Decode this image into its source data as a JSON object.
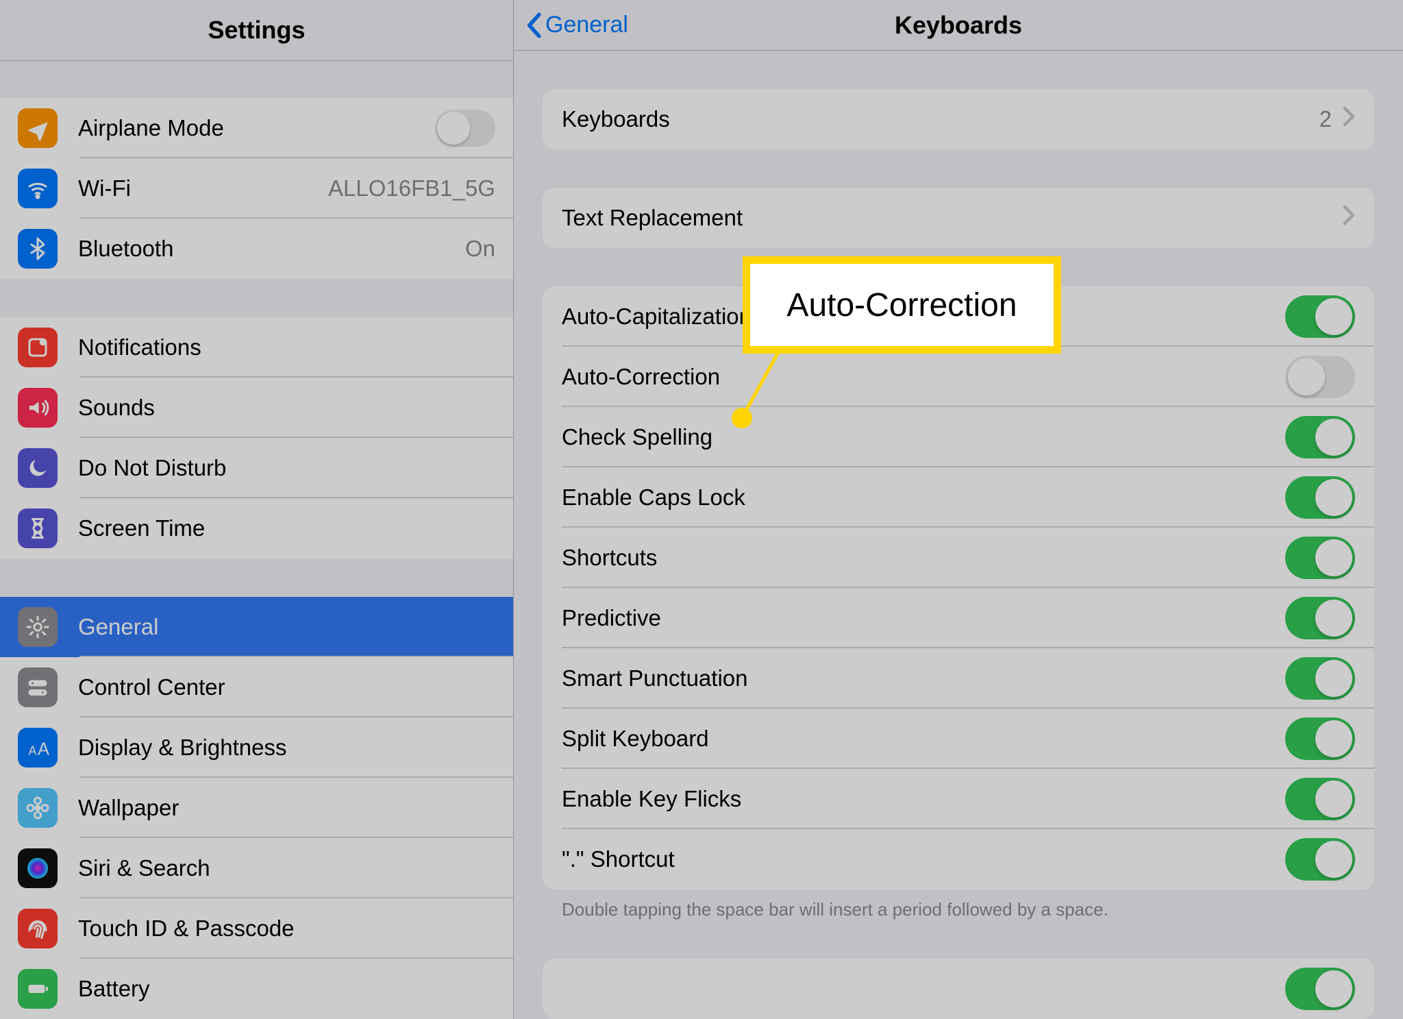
{
  "sidebar": {
    "title": "Settings",
    "groups": [
      {
        "items": [
          {
            "id": "airplane",
            "label": "Airplane Mode",
            "icon": "airplane-icon",
            "iconColor": "#ff9500",
            "type": "toggle",
            "on": false
          },
          {
            "id": "wifi",
            "label": "Wi-Fi",
            "icon": "wifi-icon",
            "iconColor": "#007aff",
            "type": "value",
            "value": "ALLO16FB1_5G"
          },
          {
            "id": "bluetooth",
            "label": "Bluetooth",
            "icon": "bluetooth-icon",
            "iconColor": "#007aff",
            "type": "value",
            "value": "On"
          }
        ]
      },
      {
        "items": [
          {
            "id": "notifications",
            "label": "Notifications",
            "icon": "notifications-icon",
            "iconColor": "#ff3b30"
          },
          {
            "id": "sounds",
            "label": "Sounds",
            "icon": "sounds-icon",
            "iconColor": "#ff2d55"
          },
          {
            "id": "dnd",
            "label": "Do Not Disturb",
            "icon": "moon-icon",
            "iconColor": "#5856d6"
          },
          {
            "id": "screentime",
            "label": "Screen Time",
            "icon": "hourglass-icon",
            "iconColor": "#5856d6"
          }
        ]
      },
      {
        "items": [
          {
            "id": "general",
            "label": "General",
            "icon": "gear-icon",
            "iconColor": "#8e8e93",
            "selected": true
          },
          {
            "id": "controlcenter",
            "label": "Control Center",
            "icon": "toggles-icon",
            "iconColor": "#8e8e93"
          },
          {
            "id": "display",
            "label": "Display & Brightness",
            "icon": "text-size-icon",
            "iconColor": "#007aff"
          },
          {
            "id": "wallpaper",
            "label": "Wallpaper",
            "icon": "flower-icon",
            "iconColor": "#54c7fc"
          },
          {
            "id": "siri",
            "label": "Siri & Search",
            "icon": "siri-icon",
            "iconColor": "#111"
          },
          {
            "id": "touchid",
            "label": "Touch ID & Passcode",
            "icon": "fingerprint-icon",
            "iconColor": "#ff3b30"
          },
          {
            "id": "battery",
            "label": "Battery",
            "icon": "battery-icon",
            "iconColor": "#34c759"
          }
        ]
      }
    ]
  },
  "detail": {
    "back": "General",
    "title": "Keyboards",
    "sections": [
      {
        "rows": [
          {
            "id": "keyboards",
            "label": "Keyboards",
            "value": "2",
            "type": "link"
          }
        ]
      },
      {
        "rows": [
          {
            "id": "textreplacement",
            "label": "Text Replacement",
            "type": "link"
          }
        ]
      },
      {
        "rows": [
          {
            "id": "autocap",
            "label": "Auto-Capitalization",
            "type": "toggle",
            "on": true
          },
          {
            "id": "autocorrect",
            "label": "Auto-Correction",
            "type": "toggle",
            "on": false
          },
          {
            "id": "spelling",
            "label": "Check Spelling",
            "type": "toggle",
            "on": true
          },
          {
            "id": "capslock",
            "label": "Enable Caps Lock",
            "type": "toggle",
            "on": true
          },
          {
            "id": "shortcuts",
            "label": "Shortcuts",
            "type": "toggle",
            "on": true
          },
          {
            "id": "predictive",
            "label": "Predictive",
            "type": "toggle",
            "on": true
          },
          {
            "id": "smartpunct",
            "label": "Smart Punctuation",
            "type": "toggle",
            "on": true
          },
          {
            "id": "splitkb",
            "label": "Split Keyboard",
            "type": "toggle",
            "on": true
          },
          {
            "id": "keyflicks",
            "label": "Enable Key Flicks",
            "type": "toggle",
            "on": true
          },
          {
            "id": "dotshortcut",
            "label": "\".\" Shortcut",
            "type": "toggle",
            "on": true
          }
        ],
        "footer": "Double tapping the space bar will insert a period followed by a space."
      },
      {
        "rows": [
          {
            "id": "nextsection",
            "label": "",
            "type": "toggle",
            "on": true
          }
        ]
      }
    ]
  },
  "callout": {
    "label": "Auto-Correction"
  },
  "colors": {
    "accent": "#007aff",
    "toggleOn": "#34c759"
  }
}
